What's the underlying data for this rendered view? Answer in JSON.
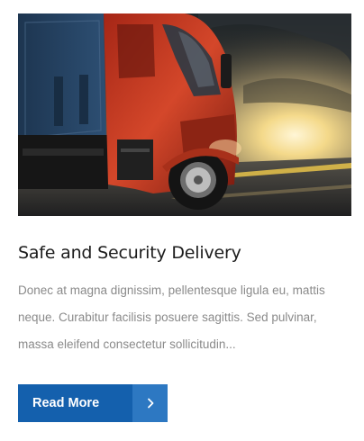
{
  "post": {
    "image_alt": "Red semi truck driving on a highway at sunset",
    "title": "Safe and Security Delivery",
    "excerpt": "Donec at magna dignissim, pellentesque ligula eu, mattis neque. Curabitur facilisis posuere sagittis. Sed pulvinar, massa eleifend consectetur sollicitudin...",
    "read_more_label": "Read More",
    "arrow_icon": "chevron-right-icon"
  },
  "colors": {
    "button": "#1460ad",
    "button_arrow": "#2d78c2",
    "title": "#1c1c1c",
    "excerpt": "#8a8a8a"
  }
}
